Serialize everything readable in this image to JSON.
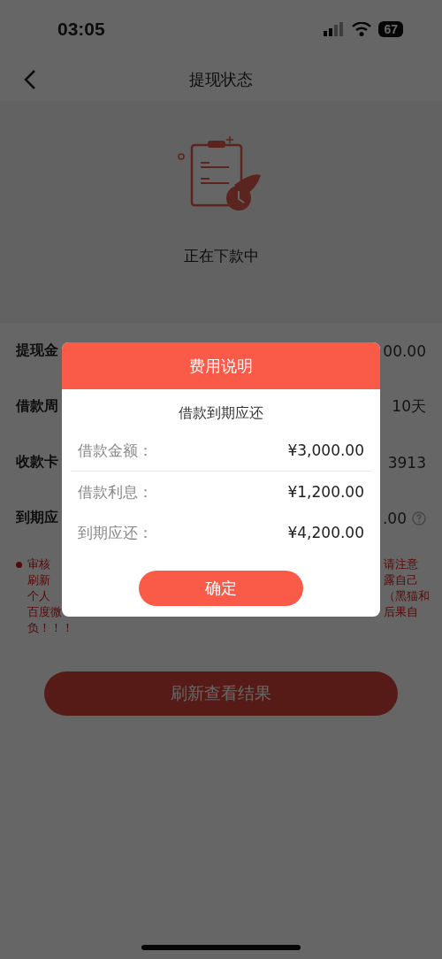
{
  "status_bar": {
    "time": "03:05",
    "battery": "67"
  },
  "nav": {
    "title": "提现状态"
  },
  "status": {
    "text": "正在下款中"
  },
  "rows": [
    {
      "label": "提现金",
      "value": "00.00",
      "help": false
    },
    {
      "label": "借款周",
      "value": "10天",
      "help": false
    },
    {
      "label": "收款卡",
      "value": "3913",
      "help": false
    },
    {
      "label": "到期应",
      "value": ".00",
      "help": true
    }
  ],
  "notice": {
    "left_lines": [
      "审核",
      "刷新",
      "个人",
      "百度微",
      "负！！！"
    ],
    "right_lines": [
      "请注意",
      "露自己",
      "（黑猫和",
      "后果自"
    ]
  },
  "refresh_button": "刷新查看结果",
  "dialog": {
    "title": "费用说明",
    "subtitle": "借款到期应还",
    "confirm": "确定",
    "items": [
      {
        "label": "借款金额：",
        "value": "¥3,000.00",
        "divider": true
      },
      {
        "label": "借款利息：",
        "value": "¥1,200.00",
        "divider": false
      },
      {
        "label": "到期应还：",
        "value": "¥4,200.00",
        "divider": false
      }
    ]
  }
}
